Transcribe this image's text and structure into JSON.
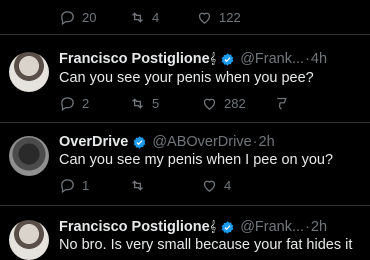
{
  "tweets": [
    {
      "name": "",
      "handle": "",
      "time": "",
      "text": "",
      "replies": "20",
      "retweets": "4",
      "likes": "122"
    },
    {
      "name": "Francisco Postiglione",
      "name_suffix": "𝄞",
      "handle": "@Frank...",
      "time": "4h",
      "text": "Can you see your penis when you pee?",
      "replies": "2",
      "retweets": "5",
      "likes": "282"
    },
    {
      "name": "OverDrive",
      "handle": "@ABOverDrive",
      "time": "2h",
      "text": "Can you see my penis when I pee on you?",
      "replies": "1",
      "retweets": "",
      "likes": "4"
    },
    {
      "name": "Francisco Postiglione",
      "name_suffix": "𝄞",
      "handle": "@Frank...",
      "time": "2h",
      "text": "No bro. Is very small because your fat hides it"
    }
  ],
  "colors": {
    "background": "#000000",
    "text": "#e7e9ea",
    "muted": "#71767b",
    "verified": "#1d9bf0"
  },
  "icons": [
    "reply-icon",
    "retweet-icon",
    "like-icon",
    "share-icon",
    "verified-badge-icon"
  ],
  "separator": "·"
}
